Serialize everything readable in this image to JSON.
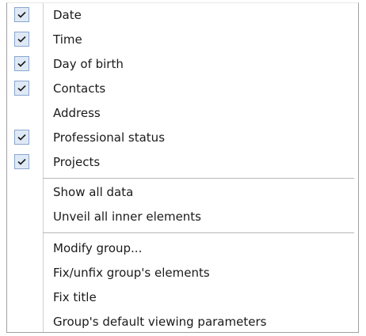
{
  "menu": {
    "group1": [
      {
        "label": "Date",
        "checked": true
      },
      {
        "label": "Time",
        "checked": true
      },
      {
        "label": "Day of birth",
        "checked": true
      },
      {
        "label": "Contacts",
        "checked": true
      },
      {
        "label": "Address",
        "checked": false
      },
      {
        "label": "Professional status",
        "checked": true
      },
      {
        "label": "Projects",
        "checked": true
      }
    ],
    "group2": [
      {
        "label": "Show all data"
      },
      {
        "label": "Unveil all inner elements"
      }
    ],
    "group3": [
      {
        "label": "Modify group..."
      },
      {
        "label": "Fix/unfix group's elements"
      },
      {
        "label": "Fix title"
      },
      {
        "label": "Group's default viewing parameters"
      }
    ]
  },
  "colors": {
    "check_bg": "#dfe9f6",
    "check_border": "#8aa6cf",
    "check_mark": "#1a1a1a"
  },
  "icons": {
    "check": "checkmark-icon"
  }
}
